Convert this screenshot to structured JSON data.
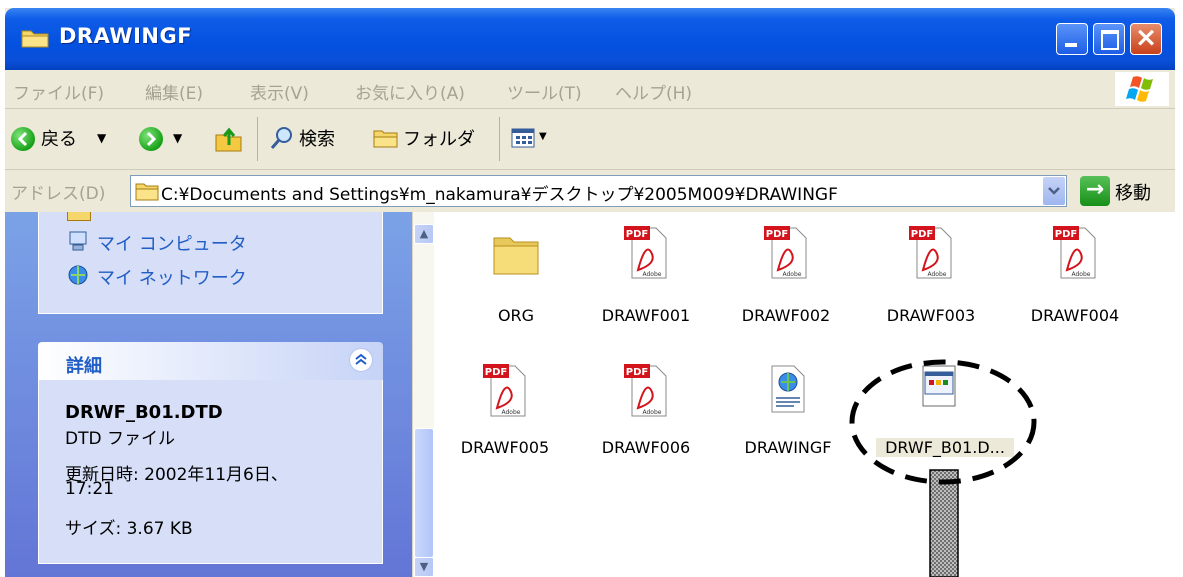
{
  "window": {
    "title": "DRAWINGF"
  },
  "menubar": {
    "items": [
      "ファイル(F)",
      "編集(E)",
      "表示(V)",
      "お気に入り(A)",
      "ツール(T)",
      "ヘルプ(H)"
    ]
  },
  "toolbar": {
    "back_label": "戻る",
    "search_label": "検索",
    "folders_label": "フォルダ"
  },
  "address": {
    "label": "アドレス(D)",
    "path": "C:¥Documents and Settings¥m_nakamura¥デスクトップ¥2005M009¥DRAWINGF",
    "go_label": "移動"
  },
  "sidebar": {
    "other_places": [
      "マイ コンピュータ",
      "マイ ネットワーク"
    ],
    "details": {
      "title": "詳細",
      "file_name": "DRWF_B01.DTD",
      "file_type": "DTD ファイル",
      "modified_line1": "更新日時: 2002年11月6日、",
      "modified_line2": "17:21",
      "size": "サイズ: 3.67 KB"
    }
  },
  "files": [
    {
      "name": "ORG",
      "icon": "folder-icon"
    },
    {
      "name": "DRAWF001",
      "icon": "pdf-icon"
    },
    {
      "name": "DRAWF002",
      "icon": "pdf-icon"
    },
    {
      "name": "DRAWF003",
      "icon": "pdf-icon"
    },
    {
      "name": "DRAWF004",
      "icon": "pdf-icon"
    },
    {
      "name": "DRAWF005",
      "icon": "pdf-icon"
    },
    {
      "name": "DRAWF006",
      "icon": "pdf-icon"
    },
    {
      "name": "DRAWINGF",
      "icon": "html-doc-icon"
    },
    {
      "name": "DRWF_B01.D...",
      "icon": "dtd-file-icon",
      "selected": true
    }
  ],
  "icons": {
    "pdf_badge": "PDF",
    "pdf_brand": "Adobe"
  },
  "colors": {
    "titlebar": "#0451e0",
    "taskpane": "#6375d6",
    "link": "#215dc6",
    "pdf_red": "#d4141c"
  }
}
